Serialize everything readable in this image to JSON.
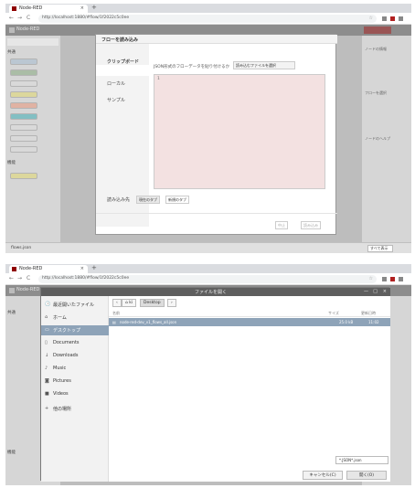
{
  "browser": {
    "tab_title": "Node-RED",
    "tab_close": "×",
    "new_tab": "+",
    "top_url": "http://localhost:1880/#flow/1f2022c5c0ee",
    "bottom_url": "http://localhost:1880/#flow/1f2022c5c0ee",
    "back": "←",
    "forward": "→",
    "reload": "C"
  },
  "nodered": {
    "title": "Node-RED",
    "palette_sections": [
      "共通",
      "機能",
      "機能"
    ],
    "sidebar_rows": [
      "ノードの情報",
      "フローを選択",
      "ノードのヘルプ"
    ],
    "status_left": "flows.json",
    "status_right": "すべて表示"
  },
  "import_dialog": {
    "title": "フローを読み込み",
    "menu": [
      "クリップボード",
      "ローカル",
      "サンプル"
    ],
    "description": "JSON形式のフローデータを貼り付けるか",
    "file_button": "読み込むファイルを選択",
    "textarea_value": "1",
    "import_to_label": "読み込み先",
    "import_to_options": [
      "現在のタブ",
      "新規のタブ"
    ],
    "cancel": "中止",
    "import": "読み込み"
  },
  "file_dialog": {
    "title": "ファイルを開く",
    "window_controls": [
      "—",
      "□",
      "×"
    ],
    "places": [
      {
        "icon": "🕓",
        "label": "最近開いたファイル",
        "selected": false
      },
      {
        "icon": "⌂",
        "label": "ホーム",
        "selected": false
      },
      {
        "icon": "▭",
        "label": "デスクトップ",
        "selected": true
      },
      {
        "icon": "▯",
        "label": "Documents",
        "selected": false
      },
      {
        "icon": "↓",
        "label": "Downloads",
        "selected": false
      },
      {
        "icon": "♪",
        "label": "Music",
        "selected": false
      },
      {
        "icon": "◙",
        "label": "Pictures",
        "selected": false
      },
      {
        "icon": "■",
        "label": "Videos",
        "selected": false
      },
      {
        "icon": "+",
        "label": "他の場所",
        "selected": false
      }
    ],
    "path_crumbs": [
      "‹",
      "⌂ ki",
      "Desktop",
      "›"
    ],
    "columns": {
      "name": "名前",
      "size": "サイズ",
      "modified": "更新日時"
    },
    "file_row": {
      "name": "node-red-dev_v1_flows_all.json",
      "size": "25.0 kB",
      "modified": "11:02"
    },
    "filter": "*.JSON*.json",
    "cancel": "キャンセル(C)",
    "open": "開く(O)"
  },
  "colors": {
    "accent_selection": "#8ea3b8",
    "nodered_header": "#8d8d8d",
    "textarea_bg": "#f3e1e1"
  }
}
